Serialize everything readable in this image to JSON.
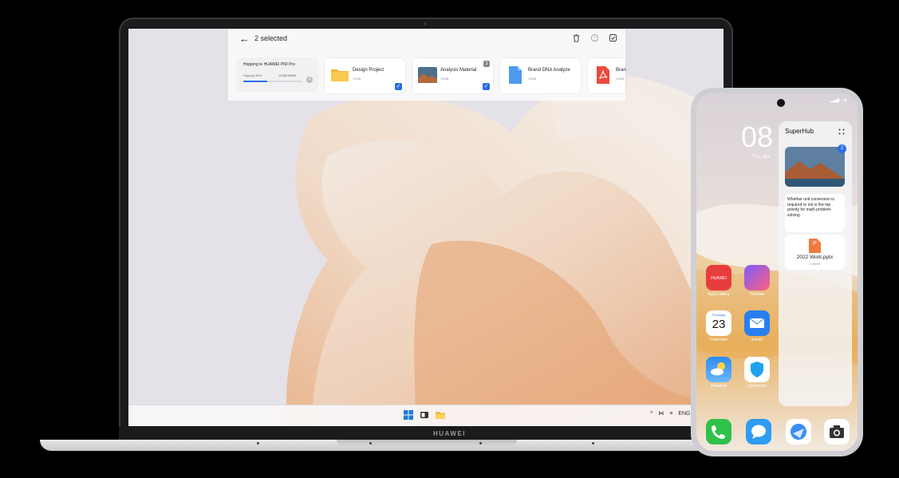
{
  "laptop": {
    "brand": "HUAWEI",
    "transfer_panel": {
      "title": "2 selected",
      "hop": {
        "title": "Hopping to HUAWEI P60 Pro",
        "progress_label": "Hopped 40%",
        "size_label": "12MB/30MB",
        "progress": 0.4
      },
      "files": [
        {
          "name": "Design Project",
          "size": "10MB",
          "icon": "folder-icon",
          "checked": true
        },
        {
          "name": "Analysis Material",
          "size": "10MB",
          "icon": "image-thumbnail",
          "checked": true,
          "badge": "3"
        },
        {
          "name": "Brand DNA Analyze",
          "size": "10MB",
          "icon": "document-icon",
          "checked": false
        },
        {
          "name": "Bran",
          "size": "10MB",
          "icon": "pdf-icon",
          "checked": false
        }
      ]
    },
    "taskbar": {
      "tray_lang": "ENG"
    }
  },
  "phone": {
    "clock": "08",
    "date": "Thu, Ma",
    "superhub": {
      "title": "SuperHub",
      "image_count": "2",
      "note": "Whether unit conversion is required or not is the top priority for math problem-solving.",
      "file_name": "2022 Work.pptx",
      "file_size": "2.39MB",
      "file_icon_letter": "P"
    },
    "apps": [
      {
        "label": "AppGallery",
        "icon_text": "HUAWEI"
      },
      {
        "label": "Themes"
      },
      {
        "label": "Calendar",
        "day_name": "Thursday",
        "day": "23"
      },
      {
        "label": "Email"
      },
      {
        "label": "Weather"
      },
      {
        "label": "Optimizer"
      }
    ]
  }
}
